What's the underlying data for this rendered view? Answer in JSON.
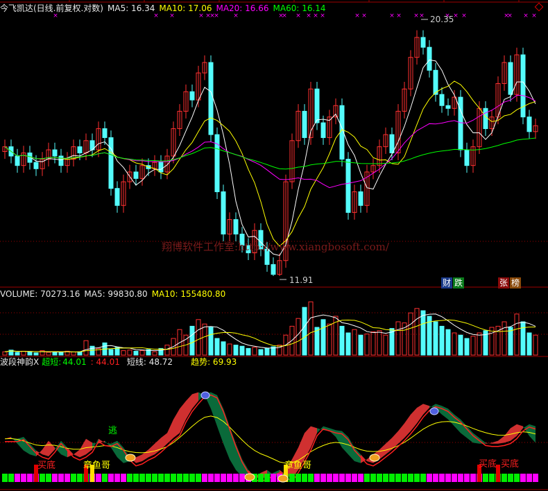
{
  "header": {
    "title": "今飞凯达(日线.前复权.对数)",
    "ma5": "MA5: 16.34",
    "ma10": "MA10: 17.06",
    "ma20": "MA20: 16.66",
    "ma60": "MA60: 16.14"
  },
  "volume_header": {
    "volume": "VOLUME: 70273.16",
    "ma5": "MA5: 99830.80",
    "ma10": "MA10: 155480.80"
  },
  "indicator_header": {
    "name": "波段神韵X",
    "chaoduan_label": "超短:",
    "chaoduan_value": "44.01",
    "red_value": ": 44.01",
    "duanxian": "短线: 48.72",
    "qushi": "趋势: 69.93"
  },
  "watermark": "翔博软件工作室:http://www.xiangbosoft.com/",
  "annotations": {
    "high": "20.35",
    "low": "11.91"
  },
  "tags": [
    {
      "text": "财",
      "color": "#1a3a8a"
    },
    {
      "text": "跌",
      "color": "#0a7a1a"
    },
    {
      "text": "张",
      "color": "#8a0a0a"
    },
    {
      "text": "榜",
      "color": "#8a4a0a"
    }
  ],
  "signals": {
    "buy_bottom": "买底",
    "octopus": "章鱼哥",
    "escape": "逃"
  },
  "colors": {
    "up": "#ff3030",
    "down": "#54fcfc",
    "ma5": "#ffffff",
    "ma10": "#ffff00",
    "ma20": "#ff00ff",
    "ma60": "#00ff00",
    "grid": "#a00000"
  },
  "chart_data": {
    "type": "candlestick",
    "scale": "log",
    "close": [
      15.6,
      15.3,
      15.0,
      15.4,
      15.1,
      14.9,
      15.2,
      15.5,
      15.3,
      15.0,
      15.2,
      15.6,
      15.4,
      15.8,
      15.5,
      16.2,
      15.9,
      14.3,
      13.8,
      14.5,
      14.8,
      14.6,
      15.0,
      14.9,
      15.1,
      14.8,
      15.3,
      16.2,
      16.8,
      17.5,
      17.2,
      18.2,
      18.6,
      16.0,
      14.2,
      13.0,
      13.4,
      13.0,
      12.7,
      12.5,
      13.1,
      12.6,
      12.2,
      11.95,
      12.3,
      14.5,
      15.8,
      16.8,
      15.9,
      17.6,
      16.4,
      15.9,
      16.6,
      17.0,
      15.2,
      13.6,
      14.2,
      13.8,
      14.8,
      15.0,
      15.6,
      16.0,
      15.4,
      16.8,
      17.6,
      18.8,
      19.6,
      19.2,
      18.3,
      17.4,
      17.0,
      16.9,
      17.3,
      15.5,
      15.0,
      15.6,
      16.9,
      16.2,
      16.6,
      17.8,
      18.6,
      17.4,
      18.9,
      16.6,
      16.1,
      16.3
    ],
    "price_range": [
      11.91,
      20.35
    ],
    "volume": [
      30000,
      45000,
      25000,
      35000,
      30000,
      20000,
      40000,
      25000,
      30000,
      22000,
      35000,
      28000,
      30000,
      130000,
      80000,
      60000,
      110000,
      50000,
      70000,
      40000,
      45000,
      35000,
      40000,
      50000,
      30000,
      60000,
      90000,
      150000,
      230000,
      180000,
      260000,
      320000,
      280000,
      250000,
      150000,
      120000,
      100000,
      90000,
      80000,
      60000,
      70000,
      50000,
      60000,
      75000,
      90000,
      180000,
      260000,
      330000,
      430000,
      480000,
      250000,
      320000,
      280000,
      350000,
      260000,
      200000,
      230000,
      180000,
      190000,
      210000,
      220000,
      180000,
      240000,
      300000,
      290000,
      380000,
      420000,
      400000,
      350000,
      300000,
      260000,
      230000,
      200000,
      180000,
      150000,
      170000,
      200000,
      220000,
      250000,
      260000,
      300000,
      250000,
      370000,
      300000,
      200000,
      180000
    ],
    "volume_max": 500000,
    "chaoduan": [
      48,
      50,
      43,
      36,
      32,
      30,
      37,
      46,
      39,
      32,
      29,
      32,
      37,
      48,
      44,
      43,
      46,
      39,
      29,
      23,
      25,
      29,
      32,
      37,
      43,
      49,
      54,
      68,
      79,
      87,
      94,
      96,
      93,
      79,
      61,
      43,
      27,
      16,
      9,
      7,
      9,
      13,
      16,
      11,
      7,
      16,
      27,
      39,
      54,
      61,
      59,
      57,
      56,
      50,
      39,
      32,
      25,
      23,
      27,
      32,
      37,
      43,
      49,
      56,
      64,
      73,
      80,
      84,
      82,
      79,
      73,
      68,
      61,
      54,
      49,
      44,
      43,
      43,
      44,
      46,
      51,
      59,
      63,
      61,
      51,
      44
    ],
    "indicator_range": [
      0,
      100
    ]
  }
}
